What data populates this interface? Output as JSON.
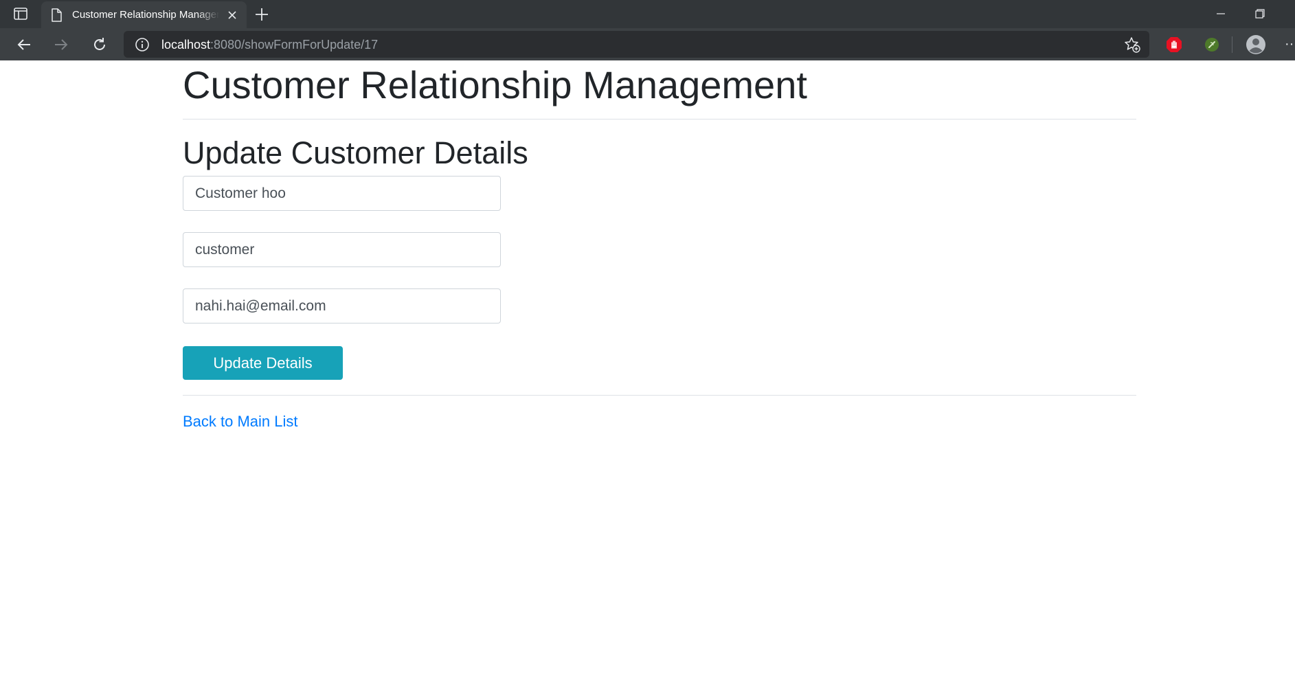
{
  "browser": {
    "tab_title": "Customer Relationship Management",
    "url_host": "localhost",
    "url_path": ":8080/showFormForUpdate/17",
    "icons": {
      "tab_actions": "tab-actions-icon",
      "page": "page-icon",
      "close": "close-icon",
      "new_tab": "plus-icon",
      "back": "back-arrow-icon",
      "forward": "forward-arrow-icon",
      "reload": "reload-icon",
      "site_info": "info-icon",
      "favorite": "star-add-icon",
      "extension_1": "red-hand-extension-icon",
      "extension_2": "green-leaf-extension-icon",
      "profile": "profile-avatar-icon",
      "more": "more-dots-icon"
    },
    "more_label": "···"
  },
  "page": {
    "app_title": "Customer Relationship Management",
    "section_title": "Update Customer Details",
    "form": {
      "first_name_value": "Customer hoo",
      "last_name_value": "customer",
      "email_value": "nahi.hai@email.com",
      "submit_label": "Update Details"
    },
    "back_link_label": "Back to Main List"
  },
  "colors": {
    "button_bg": "#17a2b8",
    "link": "#007bff",
    "heading_text": "#212529",
    "chrome_tabbar": "#323639",
    "chrome_toolbar": "#3c4043"
  }
}
